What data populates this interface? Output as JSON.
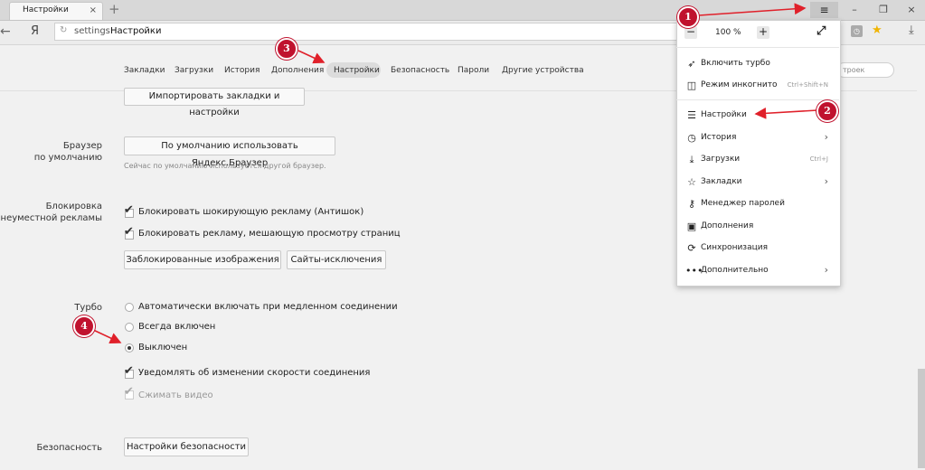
{
  "browser": {
    "tab_title": "Настройки",
    "tab_close": "×",
    "new_tab": "+",
    "back": "←",
    "logo": "Я",
    "url_prefix": "settings",
    "url_title": "Настройки",
    "win_menu": "≡",
    "win_min": "–",
    "win_restore": "❐",
    "win_close": "×"
  },
  "settings_nav": {
    "items": [
      "Закладки",
      "Загрузки",
      "История",
      "Дополнения",
      "Настройки",
      "Безопасность",
      "Пароли",
      "Другие устройства"
    ],
    "active": "Настройки",
    "search_placeholder": "троек"
  },
  "content": {
    "import_button": "Импортировать закладки и настройки",
    "default_browser": {
      "label_line1": "Браузер",
      "label_line2": "по умолчанию",
      "button": "По умолчанию использовать Яндекс.Браузер",
      "hint": "Сейчас по умолчанию используется другой браузер."
    },
    "ad_block": {
      "label_line1": "Блокировка",
      "label_line2": "неуместной рекламы",
      "option1": "Блокировать шокирующую рекламу (Антишок)",
      "option2": "Блокировать рекламу, мешающую просмотру страниц",
      "button1": "Заблокированные изображения",
      "button2": "Сайты-исключения"
    },
    "turbo": {
      "label": "Турбо",
      "radio1": "Автоматически включать при медленном соединении",
      "radio2": "Всегда включен",
      "radio3": "Выключен",
      "selected": "Выключен",
      "check1": "Уведомлять об изменении скорости соединения",
      "check2": "Сжимать видео"
    },
    "security": {
      "label": "Безопасность",
      "button": "Настройки безопасности"
    }
  },
  "menu": {
    "zoom_minus": "−",
    "zoom_value": "100 %",
    "zoom_plus": "+",
    "fullscreen": "⤢",
    "items": [
      {
        "label": "Включить турбо",
        "icon": "rocket-icon",
        "shortcut": "",
        "submenu": false
      },
      {
        "label": "Режим инкогнито",
        "icon": "incognito-icon",
        "shortcut": "Ctrl+Shift+N",
        "submenu": false
      },
      {
        "label": "Настройки",
        "icon": "sliders-icon",
        "shortcut": "",
        "submenu": false
      },
      {
        "label": "История",
        "icon": "clock-icon",
        "shortcut": "",
        "submenu": true
      },
      {
        "label": "Загрузки",
        "icon": "download-icon",
        "shortcut": "Ctrl+J",
        "submenu": false
      },
      {
        "label": "Закладки",
        "icon": "star-icon",
        "shortcut": "",
        "submenu": true
      },
      {
        "label": "Менеджер паролей",
        "icon": "key-icon",
        "shortcut": "",
        "submenu": false
      },
      {
        "label": "Дополнения",
        "icon": "puzzle-icon",
        "shortcut": "",
        "submenu": false
      },
      {
        "label": "Синхронизация",
        "icon": "sync-icon",
        "shortcut": "",
        "submenu": false
      },
      {
        "label": "Дополнительно",
        "icon": "more-icon",
        "shortcut": "",
        "submenu": true
      }
    ]
  },
  "callouts": [
    "1",
    "2",
    "3",
    "4"
  ],
  "colors": {
    "callout": "#c0122e",
    "arrow": "#e0202a",
    "star": "#f0b400"
  }
}
